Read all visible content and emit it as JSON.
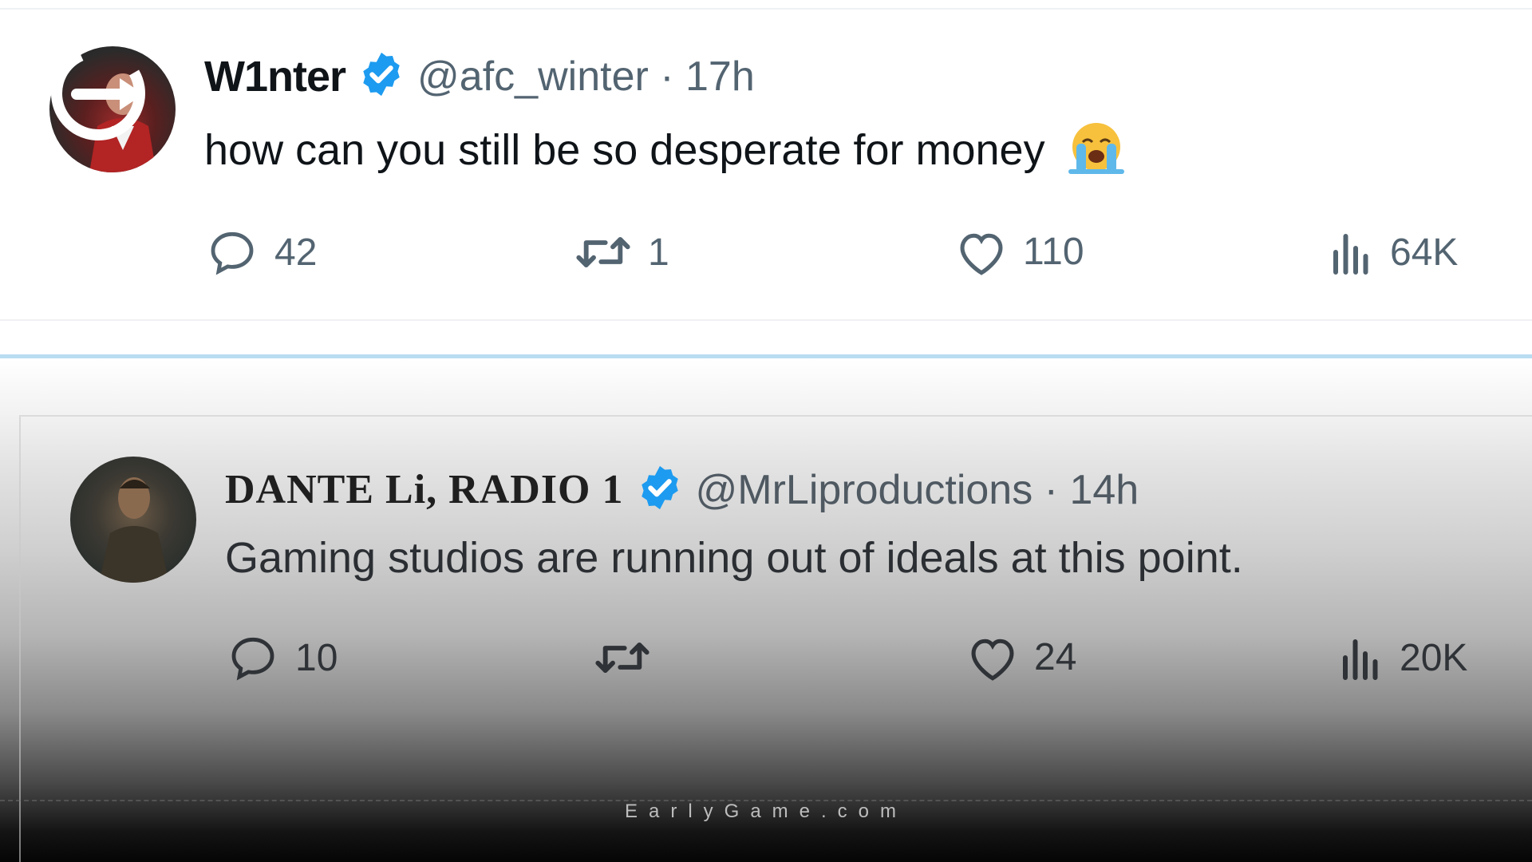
{
  "tweets": [
    {
      "display_name": "W1nter",
      "handle_time": "@afc_winter · 17h",
      "text": "how can you still be so desperate for money",
      "emoji": "loudly-crying-face",
      "stats": {
        "replies": "42",
        "retweets": "1",
        "likes": "110",
        "views": "64K"
      }
    },
    {
      "display_name": "DANTE Li, RADIO 1",
      "handle_time": "@MrLiproductions · 14h",
      "text": "Gaming studios are running out of ideals at this point.",
      "stats": {
        "replies": "10",
        "retweets": "",
        "likes": "24",
        "views": "20K"
      }
    }
  ],
  "footer": {
    "watermark": "EarlyGame.com"
  },
  "colors": {
    "verified_blue": "#1d9bf0",
    "text_primary": "#0f1419",
    "text_secondary": "#536471",
    "divider_blue": "#b9ddf2"
  },
  "icons": [
    "reply-icon",
    "retweet-icon",
    "like-icon",
    "views-icon",
    "verified-badge-icon",
    "earlygame-logo"
  ]
}
